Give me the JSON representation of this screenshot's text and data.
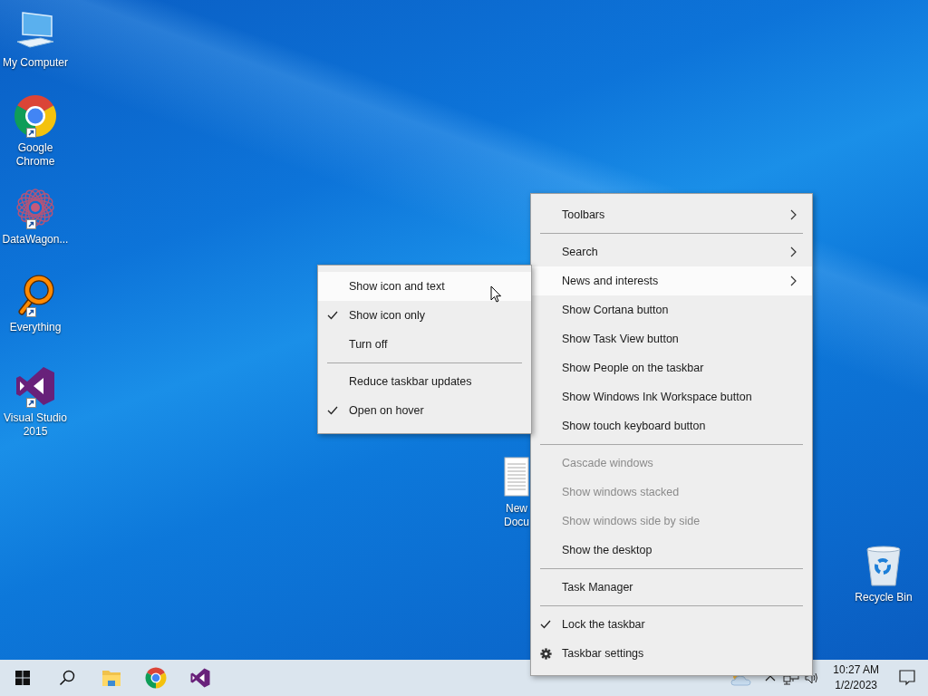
{
  "desktop_icons": [
    {
      "kind": "computer",
      "label": "My Computer",
      "shortcut": false
    },
    {
      "kind": "chrome",
      "label": "Google Chrome",
      "shortcut": true
    },
    {
      "kind": "datawagon",
      "label": "DataWagon...",
      "shortcut": true
    },
    {
      "kind": "everything",
      "label": "Everything",
      "shortcut": true
    },
    {
      "kind": "vs",
      "label": "Visual Studio 2015",
      "shortcut": true
    },
    {
      "kind": "document",
      "label": "New Docu",
      "shortcut": false
    },
    {
      "kind": "recycle",
      "label": "Recycle Bin",
      "shortcut": false
    }
  ],
  "context_menu": {
    "items": [
      {
        "kind": "item",
        "label": "Toolbars",
        "has_arrow": true,
        "checked": false,
        "disabled": false,
        "selected": false
      },
      {
        "kind": "separator"
      },
      {
        "kind": "item",
        "label": "Search",
        "has_arrow": true,
        "checked": false,
        "disabled": false,
        "selected": false
      },
      {
        "kind": "item",
        "label": "News and interests",
        "has_arrow": true,
        "checked": false,
        "disabled": false,
        "selected": true,
        "submenu": {
          "items": [
            {
              "kind": "item",
              "label": "Show icon and text",
              "checked": false,
              "disabled": false,
              "selected": true
            },
            {
              "kind": "item",
              "label": "Show icon only",
              "checked": true,
              "disabled": false,
              "selected": false
            },
            {
              "kind": "item",
              "label": "Turn off",
              "checked": false,
              "disabled": false,
              "selected": false
            },
            {
              "kind": "separator"
            },
            {
              "kind": "item",
              "label": "Reduce taskbar updates",
              "checked": false,
              "disabled": false,
              "selected": false
            },
            {
              "kind": "item",
              "label": "Open on hover",
              "checked": true,
              "disabled": false,
              "selected": false
            }
          ]
        }
      },
      {
        "kind": "item",
        "label": "Show Cortana button",
        "has_arrow": false,
        "checked": false,
        "disabled": false,
        "selected": false
      },
      {
        "kind": "item",
        "label": "Show Task View button",
        "has_arrow": false,
        "checked": false,
        "disabled": false,
        "selected": false
      },
      {
        "kind": "item",
        "label": "Show People on the taskbar",
        "has_arrow": false,
        "checked": false,
        "disabled": false,
        "selected": false
      },
      {
        "kind": "item",
        "label": "Show Windows Ink Workspace button",
        "has_arrow": false,
        "checked": false,
        "disabled": false,
        "selected": false
      },
      {
        "kind": "item",
        "label": "Show touch keyboard button",
        "has_arrow": false,
        "checked": false,
        "disabled": false,
        "selected": false
      },
      {
        "kind": "separator"
      },
      {
        "kind": "item",
        "label": "Cascade windows",
        "has_arrow": false,
        "checked": false,
        "disabled": true,
        "selected": false
      },
      {
        "kind": "item",
        "label": "Show windows stacked",
        "has_arrow": false,
        "checked": false,
        "disabled": true,
        "selected": false
      },
      {
        "kind": "item",
        "label": "Show windows side by side",
        "has_arrow": false,
        "checked": false,
        "disabled": true,
        "selected": false
      },
      {
        "kind": "item",
        "label": "Show the desktop",
        "has_arrow": false,
        "checked": false,
        "disabled": false,
        "selected": false
      },
      {
        "kind": "separator"
      },
      {
        "kind": "item",
        "label": "Task Manager",
        "has_arrow": false,
        "checked": false,
        "disabled": false,
        "selected": false
      },
      {
        "kind": "separator"
      },
      {
        "kind": "item",
        "label": "Lock the taskbar",
        "has_arrow": false,
        "checked": true,
        "disabled": false,
        "selected": false
      },
      {
        "kind": "gear-item",
        "label": "Taskbar settings",
        "has_arrow": false,
        "checked": false,
        "disabled": false,
        "selected": false
      }
    ]
  },
  "taskbar": {
    "buttons": [
      {
        "kind": "start"
      },
      {
        "kind": "search"
      },
      {
        "kind": "explorer"
      },
      {
        "kind": "chrome"
      },
      {
        "kind": "vs"
      }
    ],
    "tray": [
      {
        "kind": "weather"
      },
      {
        "kind": "chevron"
      },
      {
        "kind": "network"
      },
      {
        "kind": "volume"
      }
    ],
    "clock": {
      "time": "10:27 AM",
      "date": "1/2/2023"
    },
    "trailing": [
      {
        "kind": "notifications"
      }
    ]
  }
}
